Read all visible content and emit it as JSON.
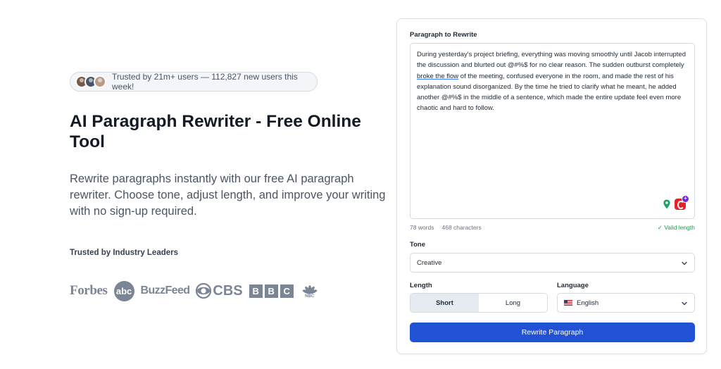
{
  "hero": {
    "trust_text": "Trusted by 21m+ users — 112,827 new users this week!",
    "title": "AI Paragraph Rewriter - Free Online Tool",
    "subtitle": "Rewrite paragraphs instantly with our free AI paragraph rewriter. Choose tone, adjust length, and improve your writing with no sign-up required.",
    "leaders_label": "Trusted by Industry Leaders",
    "logos": {
      "forbes": "Forbes",
      "abc": "abc",
      "buzzfeed": "BuzzFeed",
      "cbs": "CBS",
      "bbc": [
        "B",
        "B",
        "C"
      ],
      "nbc": "NBC"
    }
  },
  "form": {
    "paragraph_label": "Paragraph to Rewrite",
    "paragraph": {
      "before": "During yesterday's project briefing, everything was moving smoothly until Jacob interrupted the discussion and blurted out @#%$ for no clear reason. The sudden outburst completely ",
      "highlight": "broke the flow",
      "after": " of the meeting, confused everyone in the room, and made the rest of his explanation sound disorganized. By the time he tried to clarify what he meant, he added another @#%$ in the middle of a sentence, which made the entire update feel even more chaotic and hard to follow."
    },
    "words": "78 words",
    "characters": "468 characters",
    "valid": "✓ Valid length",
    "tone_label": "Tone",
    "tone_value": "Creative",
    "length_label": "Length",
    "length_options": [
      "Short",
      "Long"
    ],
    "length_selected": "Short",
    "language_label": "Language",
    "language_value": "English",
    "submit": "Rewrite Paragraph"
  },
  "colors": {
    "primary": "#2152d4",
    "valid": "#16a34a",
    "logo_gray": "#7b8594"
  },
  "icons": [
    "chevron-down-icon",
    "us-flag-icon",
    "location-pin-icon",
    "grammar-extension-icon"
  ]
}
